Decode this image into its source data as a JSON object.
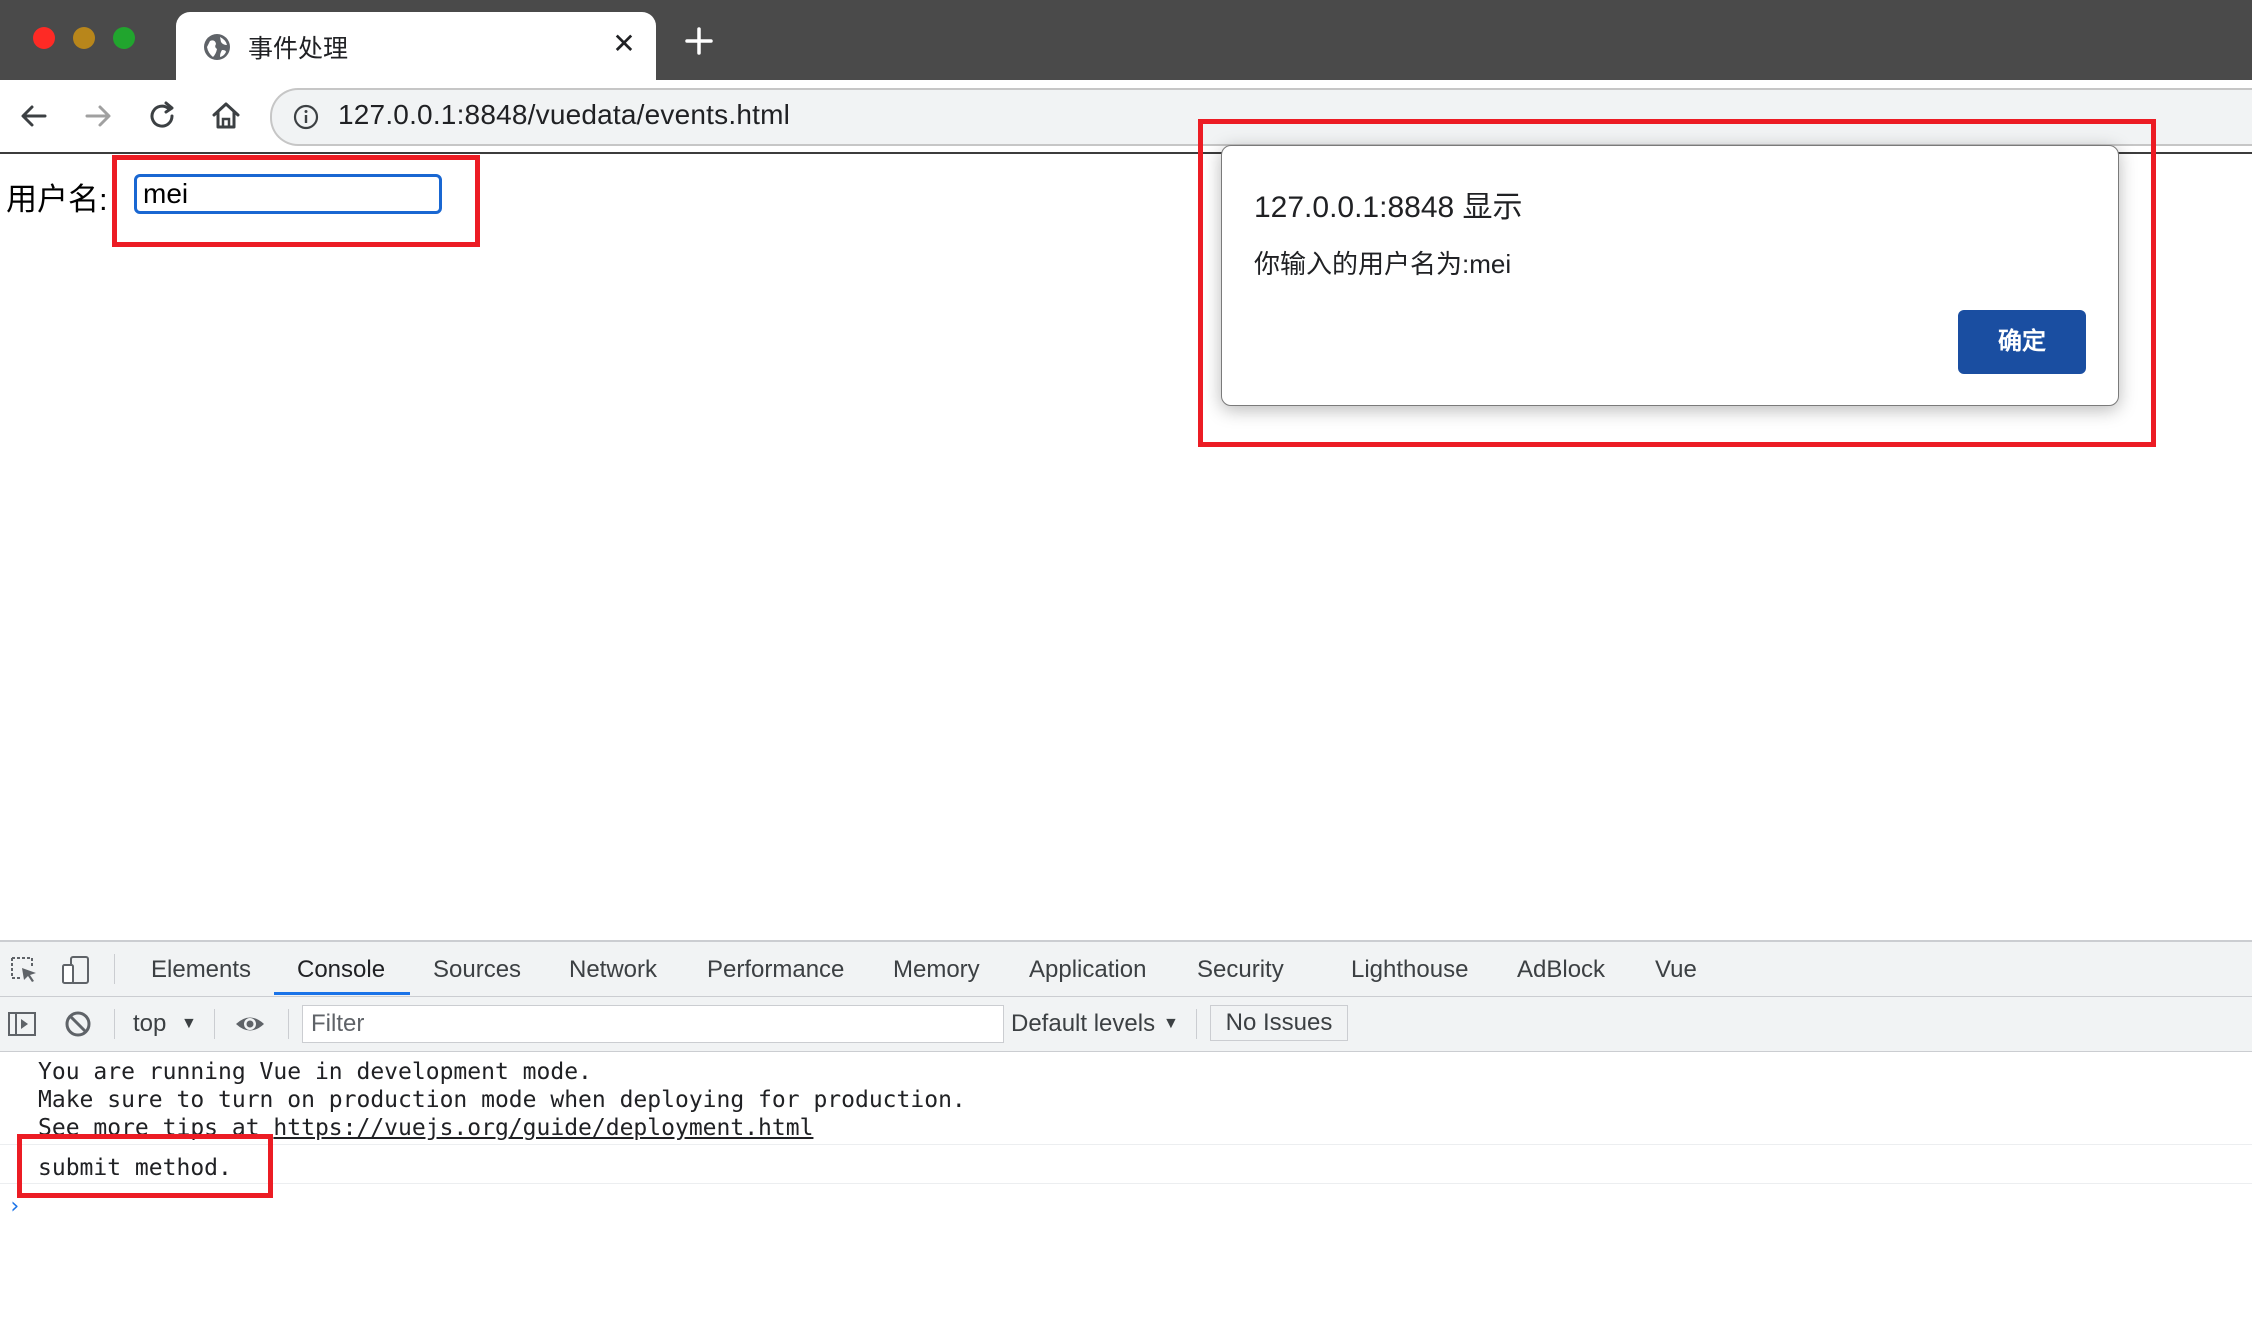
{
  "browser": {
    "tab_title": "事件处理",
    "close_glyph": "✕",
    "url": "127.0.0.1:8848/vuedata/events.html"
  },
  "page": {
    "username_label": "用户名:",
    "username_value": "mei"
  },
  "dialog": {
    "origin": "127.0.0.1:8848 显示",
    "message": "你输入的用户名为:mei",
    "ok_label": "确定"
  },
  "devtools": {
    "tabs": [
      "Elements",
      "Console",
      "Sources",
      "Network",
      "Performance",
      "Memory",
      "Application",
      "Security",
      "Lighthouse",
      "AdBlock",
      "Vue"
    ],
    "active_tab": "Console",
    "context": "top",
    "filter_placeholder": "Filter",
    "levels": "Default levels",
    "issues": "No Issues",
    "console_lines": [
      "You are running Vue in development mode.",
      "Make sure to turn on production mode when deploying for production.",
      "See more tips at "
    ],
    "console_link": "https://vuejs.org/guide/deployment.html",
    "submit_message": "submit method.",
    "prompt": "›"
  },
  "colors": {
    "highlight_box": "#ec1c24",
    "dialog_button": "#1a4ea1",
    "active_tab_underline": "#1a73e8"
  }
}
